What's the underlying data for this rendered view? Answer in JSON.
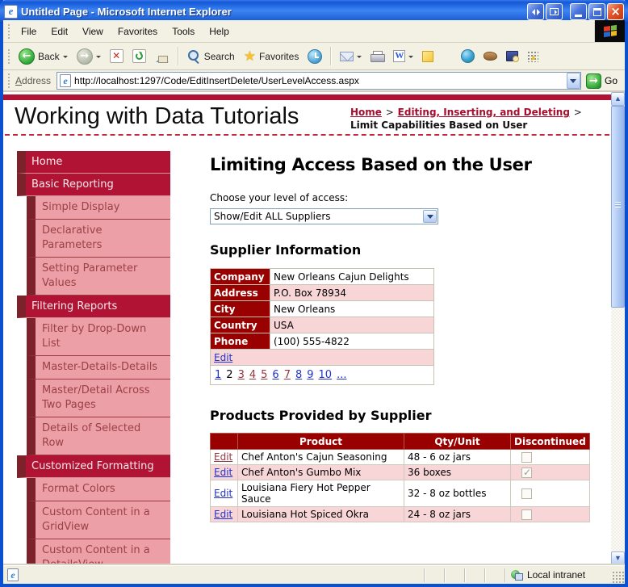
{
  "window": {
    "title": "Untitled Page - Microsoft Internet Explorer"
  },
  "menu": {
    "items": [
      "File",
      "Edit",
      "View",
      "Favorites",
      "Tools",
      "Help"
    ]
  },
  "toolbar": {
    "back": "Back",
    "search": "Search",
    "favorites": "Favorites"
  },
  "address": {
    "label": "Address",
    "url": "http://localhost:1297/Code/EditInsertDelete/UserLevelAccess.aspx",
    "go": "Go"
  },
  "page": {
    "title": "Working with Data Tutorials",
    "breadcrumb": {
      "home": "Home",
      "section": "Editing, Inserting, and Deleting",
      "separator": ">",
      "current": "Limit Capabilities Based on User"
    },
    "sidebar": [
      {
        "label": "Home",
        "level": 0
      },
      {
        "label": "Basic Reporting",
        "level": 0
      },
      {
        "label": "Simple Display",
        "level": 1
      },
      {
        "label": "Declarative Parameters",
        "level": 1
      },
      {
        "label": "Setting Parameter Values",
        "level": 1
      },
      {
        "label": "Filtering Reports",
        "level": 0
      },
      {
        "label": "Filter by Drop-Down List",
        "level": 1
      },
      {
        "label": "Master-Details-Details",
        "level": 1
      },
      {
        "label": "Master/Detail Across Two Pages",
        "level": 1
      },
      {
        "label": "Details of Selected Row",
        "level": 1
      },
      {
        "label": "Customized Formatting",
        "level": 0
      },
      {
        "label": "Format Colors",
        "level": 1
      },
      {
        "label": "Custom Content in a GridView",
        "level": 1
      },
      {
        "label": "Custom Content in a DetailsView",
        "level": 1
      }
    ],
    "main": {
      "heading": "Limiting Access Based on the User",
      "access_label": "Choose your level of access:",
      "access_selected": "Show/Edit ALL Suppliers",
      "supplier": {
        "heading": "Supplier Information",
        "fields": [
          {
            "label": "Company",
            "value": "New Orleans Cajun Delights"
          },
          {
            "label": "Address",
            "value": "P.O. Box 78934"
          },
          {
            "label": "City",
            "value": "New Orleans"
          },
          {
            "label": "Country",
            "value": "USA"
          },
          {
            "label": "Phone",
            "value": "(100) 555-4822"
          }
        ],
        "edit": "Edit",
        "pager": [
          {
            "text": "1",
            "state": "link"
          },
          {
            "text": "2",
            "state": "current"
          },
          {
            "text": "3",
            "state": "visited"
          },
          {
            "text": "4",
            "state": "visited"
          },
          {
            "text": "5",
            "state": "visited"
          },
          {
            "text": "6",
            "state": "link"
          },
          {
            "text": "7",
            "state": "visited"
          },
          {
            "text": "8",
            "state": "link"
          },
          {
            "text": "9",
            "state": "link"
          },
          {
            "text": "10",
            "state": "link"
          },
          {
            "text": "...",
            "state": "link"
          }
        ]
      },
      "products": {
        "heading": "Products Provided by Supplier",
        "columns": [
          "",
          "Product",
          "Qty/Unit",
          "Discontinued"
        ],
        "rows": [
          {
            "edit": "Edit",
            "visited": true,
            "product": "Chef Anton's Cajun Seasoning",
            "qty": "48 - 6 oz jars",
            "discontinued": false
          },
          {
            "edit": "Edit",
            "visited": false,
            "product": "Chef Anton's Gumbo Mix",
            "qty": "36 boxes",
            "discontinued": true
          },
          {
            "edit": "Edit",
            "visited": false,
            "product": "Louisiana Fiery Hot Pepper Sauce",
            "qty": "32 - 8 oz bottles",
            "discontinued": false
          },
          {
            "edit": "Edit",
            "visited": false,
            "product": "Louisiana Hot Spiced Okra",
            "qty": "24 - 8 oz jars",
            "discontinued": false
          }
        ]
      }
    }
  },
  "status": {
    "zone": "Local intranet"
  },
  "colors": {
    "crimson": "#b01334",
    "maroon_strip": "#7d212b",
    "sidebar_pink": "#ec9fa6",
    "table_header_red": "#990000",
    "row_pink": "#f8d5d7",
    "link_blue": "#2233cc",
    "link_visited": "#943640",
    "breadcrumb_red": "#a50d2d",
    "titlebar_blue": "#2a6ee8"
  }
}
